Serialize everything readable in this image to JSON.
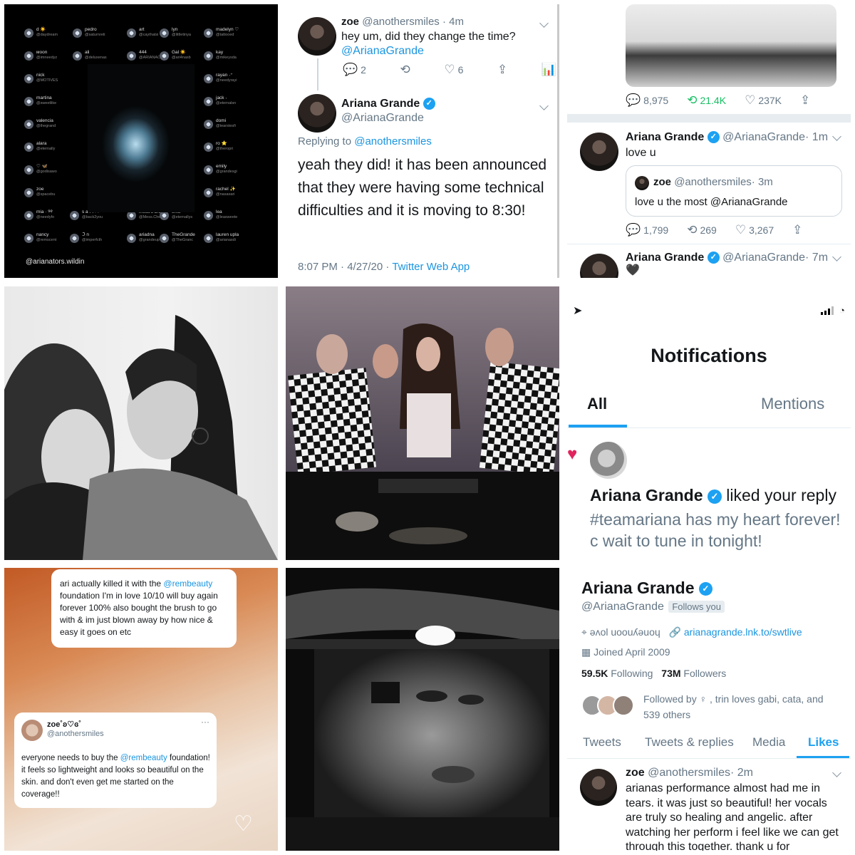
{
  "colors": {
    "twitter_blue": "#1da1f2",
    "link_blue": "#1b95e0",
    "grey": "#657786",
    "retweet_green": "#17bf63",
    "like_pink": "#e0245e"
  },
  "tile1": {
    "handle": "@arianators.wildin",
    "followers": [
      {
        "name": "d ☀️",
        "handle": "@daydream"
      },
      {
        "name": "pedro",
        "handle": "@saturnreti"
      },
      {
        "name": "art",
        "handle": "@caythatsi"
      },
      {
        "name": "lyn",
        "handle": "@littletinya"
      },
      {
        "name": "madelyn ♡",
        "handle": "@tattooed"
      },
      {
        "name": "мoon",
        "handle": "@imneedyz"
      },
      {
        "name": "ali",
        "handle": "@deluxenas"
      },
      {
        "name": "444",
        "handle": "@ARIANAC"
      },
      {
        "name": "Gal ☀️",
        "handle": "@ari4nasb"
      },
      {
        "name": "kay",
        "handle": "@mikeysda"
      },
      {
        "name": "nick",
        "handle": "@MOTIVES"
      },
      {
        "name": "rayan ˖⁺",
        "handle": "@needyrayi"
      },
      {
        "name": "martina",
        "handle": "@sweetlike"
      },
      {
        "name": "jack ˖",
        "handle": "@eternalsn"
      },
      {
        "name": "valencia",
        "handle": "@thegrand"
      },
      {
        "name": "domi",
        "handle": "@tearstesfi"
      },
      {
        "name": "alara",
        "handle": "@eternally"
      },
      {
        "name": "ro ⭐",
        "handle": "@theropri"
      },
      {
        "name": "♡ 🦋",
        "handle": "@godisawo"
      },
      {
        "name": "emily",
        "handle": "@grandesgi"
      },
      {
        "name": "zoe",
        "handle": "@spacebu"
      },
      {
        "name": "rachel ✨",
        "handle": "@nasaxari"
      },
      {
        "name": "mia · ୨୧",
        "handle": "@needyfo"
      },
      {
        "name": "s a r i ୨୧",
        "handle": "@back2you"
      },
      {
        "name": "mess's brig",
        "handle": "@Mess.Che"
      },
      {
        "name": "ems",
        "handle": "@eternallys"
      },
      {
        "name": "lea",
        "handle": "@leasweete"
      },
      {
        "name": "nancy",
        "handle": "@remscent"
      },
      {
        "name": "ℑ n",
        "handle": "@imperfcth"
      },
      {
        "name": "ariadna",
        "handle": "@grandeup"
      },
      {
        "name": "TheGrande",
        "handle": "@TheGranc"
      },
      {
        "name": "lauren upla",
        "handle": "@arianasdi"
      }
    ]
  },
  "tile2": {
    "tweet1": {
      "name": "zoe",
      "handle": "@anothersmiles",
      "time": "· 4m",
      "text": "hey um, did they change the time?",
      "mention": "@ArianaGrande",
      "replies": "2",
      "likes": "6"
    },
    "tweet2": {
      "name": "Ariana Grande",
      "handle": "@ArianaGrande",
      "replying_prefix": "Replying to",
      "replying_to": "@anothersmiles",
      "text": "yeah they did! it has been announced that they were having some technical difficulties and it is moving to 8:30!",
      "timestamp": "8:07 PM · 4/27/20 ·",
      "client": "Twitter Web App"
    }
  },
  "tile3": {
    "top_stats": {
      "replies": "8,975",
      "retweets": "21.4K",
      "likes": "237K"
    },
    "tweet1": {
      "name": "Ariana Grande",
      "handle": "@ArianaGrande",
      "time": "· 1m",
      "text": "love u"
    },
    "quote": {
      "name": "zoe",
      "handle": "@anothersmiles",
      "time": "· 3m",
      "text": "love u the most @ArianaGrande"
    },
    "stats": {
      "replies": "1,799",
      "retweets": "269",
      "likes": "3,267"
    },
    "tweet2": {
      "name": "Ariana Grande",
      "handle": "@ArianaGrande",
      "time": "· 7m",
      "text": "🖤"
    }
  },
  "tile6": {
    "title": "Notifications",
    "tabs": [
      "All",
      "Mentions"
    ],
    "notif": {
      "name": "Ariana Grande",
      "action": "liked your reply",
      "text": "#teamariana has my heart forever! c wait to tune in tonight!"
    }
  },
  "tile7": {
    "story_text": "ari actually killed it with the @rembeauty foundation I'm in love 10/10 will buy again forever 100% also bought the brush to go with & im just blown away by how nice & easy it goes on etc",
    "story_parts": {
      "a": "ari actually killed it with the",
      "mention": "@rembeauty",
      "b": "foundation I'm in love 10/10 will buy again forever 100% also bought the brush to go with & im just blown away by how nice & easy it goes on etc"
    },
    "tweet": {
      "name": "zoe˚ʚ♡ɞ˚",
      "handle": "@anothersmiles",
      "text_a": "everyone needs to buy the",
      "mention": "@rembeauty",
      "text_b": "foundation! it feels so lightweight and looks so beautiful on the skin. and don't even get me started on the coverage!!"
    }
  },
  "tile9": {
    "name": "Ariana Grande",
    "handle": "@ArianaGrande",
    "follows_you": "Follows you",
    "location": "ǝʌol uoouʎǝuoɥ",
    "link": "arianagrande.lnk.to/swtlive",
    "joined": "Joined April 2009",
    "following_count": "59.5K",
    "following_label": "Following",
    "followers_count": "73M",
    "followers_label": "Followers",
    "followed_by": "Followed by ♀ , trin loves gabi, cata, and 539 others",
    "tabs": [
      "Tweets",
      "Tweets & replies",
      "Media",
      "Likes"
    ],
    "tweet": {
      "name": "zoe",
      "handle": "@anothersmiles",
      "time": "· 2m",
      "text": "arianas performance almost had me in tears. it was just so beautiful! her vocals are truly so healing and angelic. after watching her perform i feel like we can get through this together. thank u for"
    }
  }
}
